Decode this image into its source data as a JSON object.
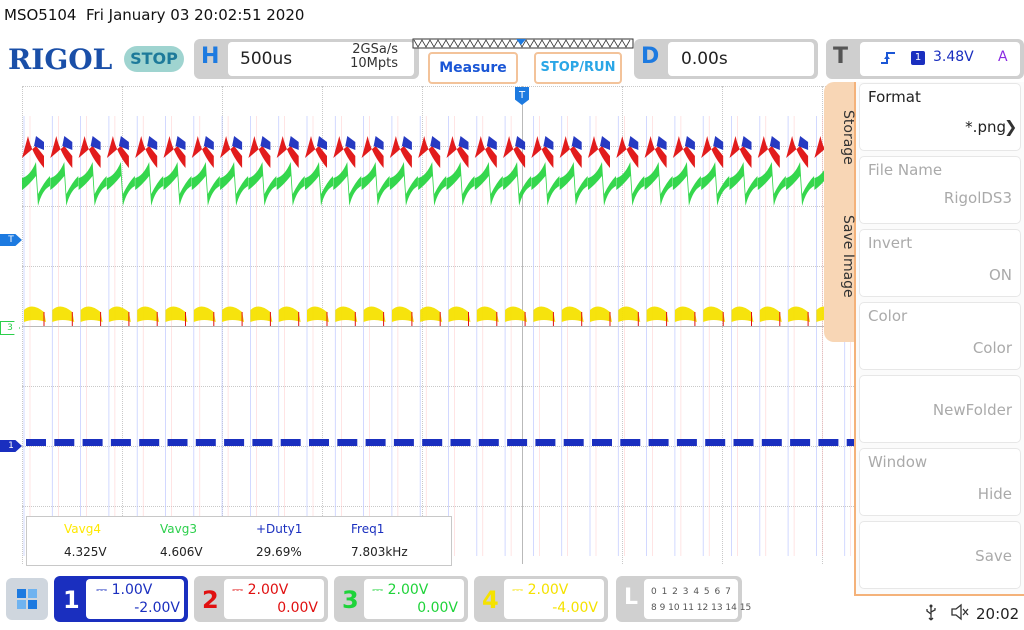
{
  "header": {
    "model": "MSO5104",
    "datetime": "Fri January 03 20:02:51 2020"
  },
  "toolbar": {
    "logo": "RIGOL",
    "run_state": "STOP",
    "horizontal": {
      "letter": "H",
      "timebase": "500us",
      "sample_rate": "2GSa/s",
      "memory_depth": "10Mpts"
    },
    "measure_label": "Measure",
    "stoprun_label": "STOP/RUN",
    "delay": {
      "letter": "D",
      "value": "0.00s"
    },
    "trigger": {
      "letter": "T",
      "edge_icon": "rising-edge-icon",
      "source": "1",
      "level": "3.48V",
      "mode": "A"
    }
  },
  "markers": {
    "trigger_level": "T",
    "ch3": "3",
    "ch1": "1",
    "trigger_pos": "T"
  },
  "measurements": [
    {
      "label": "Vavg4",
      "value": "4.325V",
      "color": "#ffe800"
    },
    {
      "label": "Vavg3",
      "value": "4.606V",
      "color": "#2bcf4b"
    },
    {
      "label": "+Duty1",
      "value": "29.69%",
      "color": "#1a2fbf"
    },
    {
      "label": "Freq1",
      "value": "7.803kHz",
      "color": "#1a2fbf"
    }
  ],
  "side_menu": {
    "tabs": [
      "Storage",
      "Save Image"
    ],
    "items": [
      {
        "title": "Format",
        "value": "*.png",
        "enabled": true
      },
      {
        "title": "File Name",
        "value": "RigolDS3",
        "enabled": false
      },
      {
        "title": "Invert",
        "value": "ON",
        "enabled": false
      },
      {
        "title": "Color",
        "value": "Color",
        "enabled": false
      },
      {
        "title": "",
        "value": "NewFolder",
        "enabled": false
      },
      {
        "title": "Window",
        "value": "Hide",
        "enabled": false
      },
      {
        "title": "",
        "value": "Save",
        "enabled": false
      }
    ]
  },
  "channels": [
    {
      "num": "1",
      "scale": "1.00V",
      "offset": "-2.00V",
      "color": "#1a2fbf",
      "active": true
    },
    {
      "num": "2",
      "scale": "2.00V",
      "offset": "0.00V",
      "color": "#e01010",
      "active": false
    },
    {
      "num": "3",
      "scale": "2.00V",
      "offset": "0.00V",
      "color": "#1fd33a",
      "active": false
    },
    {
      "num": "4",
      "scale": "2.00V",
      "offset": "-4.00V",
      "color": "#f5e200",
      "active": false
    }
  ],
  "logic": {
    "letter": "L",
    "row1": "0 1 2 3  4 5 6 7",
    "row2": "8 9 10 11 12 13 14 15"
  },
  "status": {
    "clock": "20:02"
  },
  "trace_colors": {
    "ch1": "#1a2fbf",
    "ch2": "#e01010",
    "ch3": "#1fd33a",
    "ch4": "#f5e200"
  }
}
